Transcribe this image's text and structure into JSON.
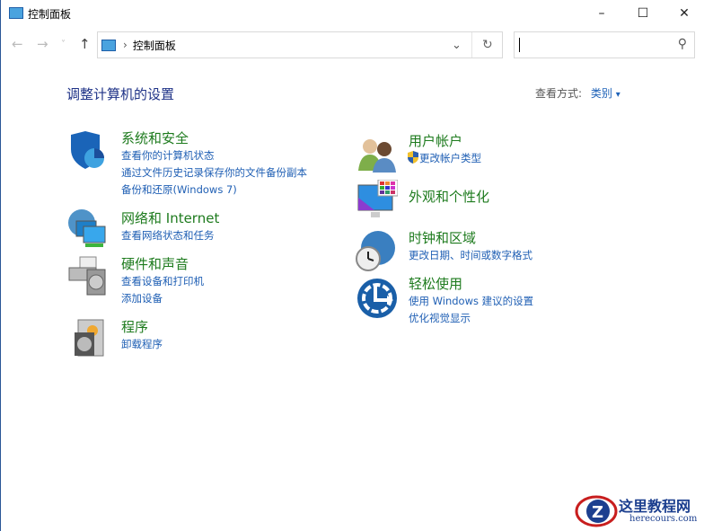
{
  "window": {
    "title": "控制面板",
    "minimize": "–",
    "maximize": "☐",
    "close": "✕"
  },
  "nav": {
    "back": "←",
    "forward": "→",
    "recent": "˅",
    "up": "↑",
    "breadcrumb_sep": "›",
    "address": "控制面板",
    "dropdown": "⌄",
    "refresh": "↻",
    "search_placeholder": "",
    "search_icon": "⚲"
  },
  "main": {
    "heading": "调整计算机的设置",
    "view_label": "查看方式:",
    "view_value": "类别",
    "view_arrow": "▾"
  },
  "categories": [
    {
      "title": "系统和安全",
      "links": [
        "查看你的计算机状态",
        "通过文件历史记录保存你的文件备份副本",
        "备份和还原(Windows 7)"
      ]
    },
    {
      "title": "网络和 Internet",
      "links": [
        "查看网络状态和任务"
      ]
    },
    {
      "title": "硬件和声音",
      "links": [
        "查看设备和打印机",
        "添加设备"
      ]
    },
    {
      "title": "程序",
      "links": [
        "卸载程序"
      ]
    },
    {
      "title": "用户帐户",
      "links": [
        "更改帐户类型"
      ]
    },
    {
      "title": "外观和个性化",
      "links": []
    },
    {
      "title": "时钟和区域",
      "links": [
        "更改日期、时间或数字格式"
      ]
    },
    {
      "title": "轻松使用",
      "links": [
        "使用 Windows 建议的设置",
        "优化视觉显示"
      ]
    }
  ],
  "watermark": {
    "name": "这里教程网",
    "url": "herecours.com"
  }
}
